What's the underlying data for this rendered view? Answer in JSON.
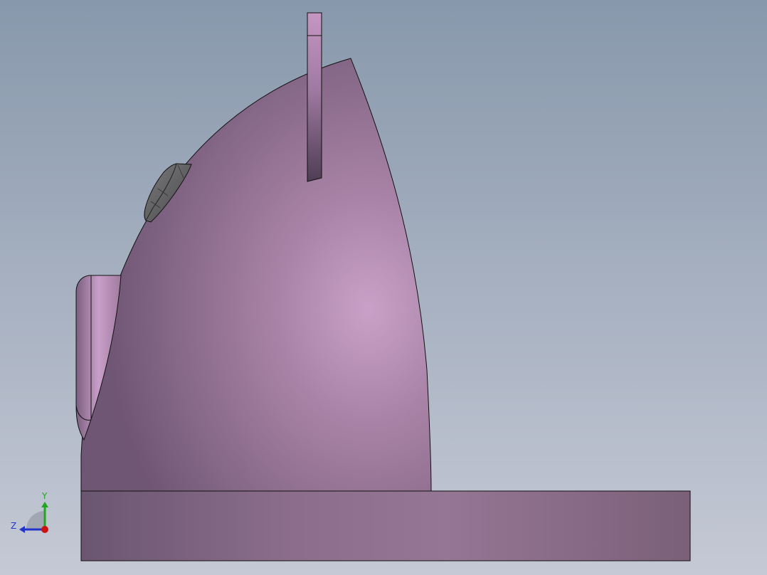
{
  "viewport": {
    "background_top": "#8a9aae",
    "background_bottom": "#c4c8d4",
    "part_color": "#a47ea2",
    "part_highlight": "#c8a0c8",
    "part_shadow": "#6c5670",
    "edge_color": "#111111",
    "knob_color": "#5e5e60"
  },
  "triad": {
    "y_label": "Y",
    "z_label": "Z",
    "y_color": "#1fa81f",
    "z_color": "#2233cc",
    "x_color": "#cc1111"
  }
}
